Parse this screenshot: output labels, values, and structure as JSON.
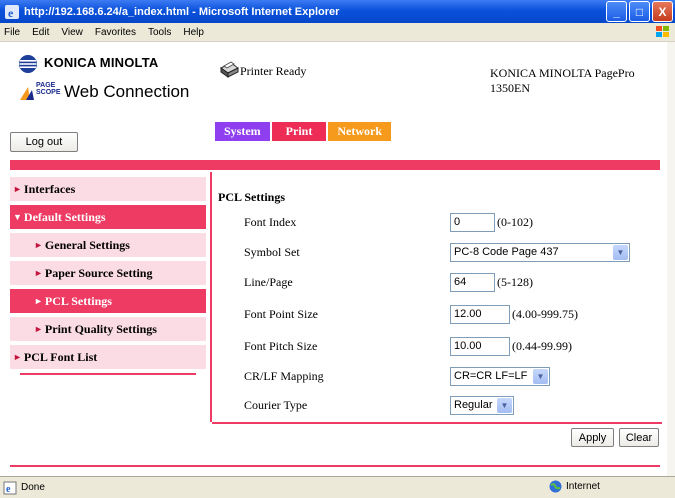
{
  "window": {
    "title": "http://192.168.6.24/a_index.html - Microsoft Internet Explorer",
    "minimize": "_",
    "maximize": "□",
    "close": "X"
  },
  "menubar": {
    "items": [
      "File",
      "Edit",
      "View",
      "Favorites",
      "Tools",
      "Help"
    ]
  },
  "header": {
    "brand": "KONICA MINOLTA",
    "page_scope": "PAGE SCOPE",
    "web_connection": "Web Connection",
    "printer_status": "Printer Ready",
    "device_name_line1": "KONICA MINOLTA PagePro",
    "device_name_line2": "1350EN",
    "logout": "Log out"
  },
  "tabs": [
    {
      "label": "System",
      "color": "#8f3ff0"
    },
    {
      "label": "Print",
      "color": "#ee2d57"
    },
    {
      "label": "Network",
      "color": "#f59a1c"
    }
  ],
  "sidebar": {
    "items": [
      {
        "label": "Interfaces",
        "arrow": "►",
        "active": false
      },
      {
        "label": "Default Settings",
        "arrow": "▼",
        "active": true
      },
      {
        "label": "General Settings",
        "arrow": "►",
        "active": false
      },
      {
        "label": "Paper Source Setting",
        "arrow": "►",
        "active": false
      },
      {
        "label": "PCL Settings",
        "arrow": "►",
        "active": true
      },
      {
        "label": "Print Quality Settings",
        "arrow": "►",
        "active": false
      },
      {
        "label": "PCL Font List",
        "arrow": "►",
        "active": false
      }
    ]
  },
  "main": {
    "title": "PCL Settings",
    "fields": {
      "font_index": {
        "label": "Font Index",
        "value": "0",
        "range": "(0-102)"
      },
      "symbol_set": {
        "label": "Symbol Set",
        "value": "PC-8 Code Page 437"
      },
      "line_page": {
        "label": "Line/Page",
        "value": "64",
        "range": "(5-128)"
      },
      "font_point_size": {
        "label": "Font Point Size",
        "value": "12.00",
        "range": "(4.00-999.75)"
      },
      "font_pitch_size": {
        "label": "Font Pitch Size",
        "value": "10.00",
        "range": "(0.44-99.99)"
      },
      "crlf_mapping": {
        "label": "CR/LF Mapping",
        "value": "CR=CR LF=LF"
      },
      "courier_type": {
        "label": "Courier Type",
        "value": "Regular"
      }
    },
    "apply": "Apply",
    "clear": "Clear"
  },
  "statusbar": {
    "status": "Done",
    "zone": "Internet"
  },
  "colors": {
    "accent": "#ee3b63",
    "sidebar_bg": "#fbdce4",
    "titlebar": "#0a52dc"
  }
}
